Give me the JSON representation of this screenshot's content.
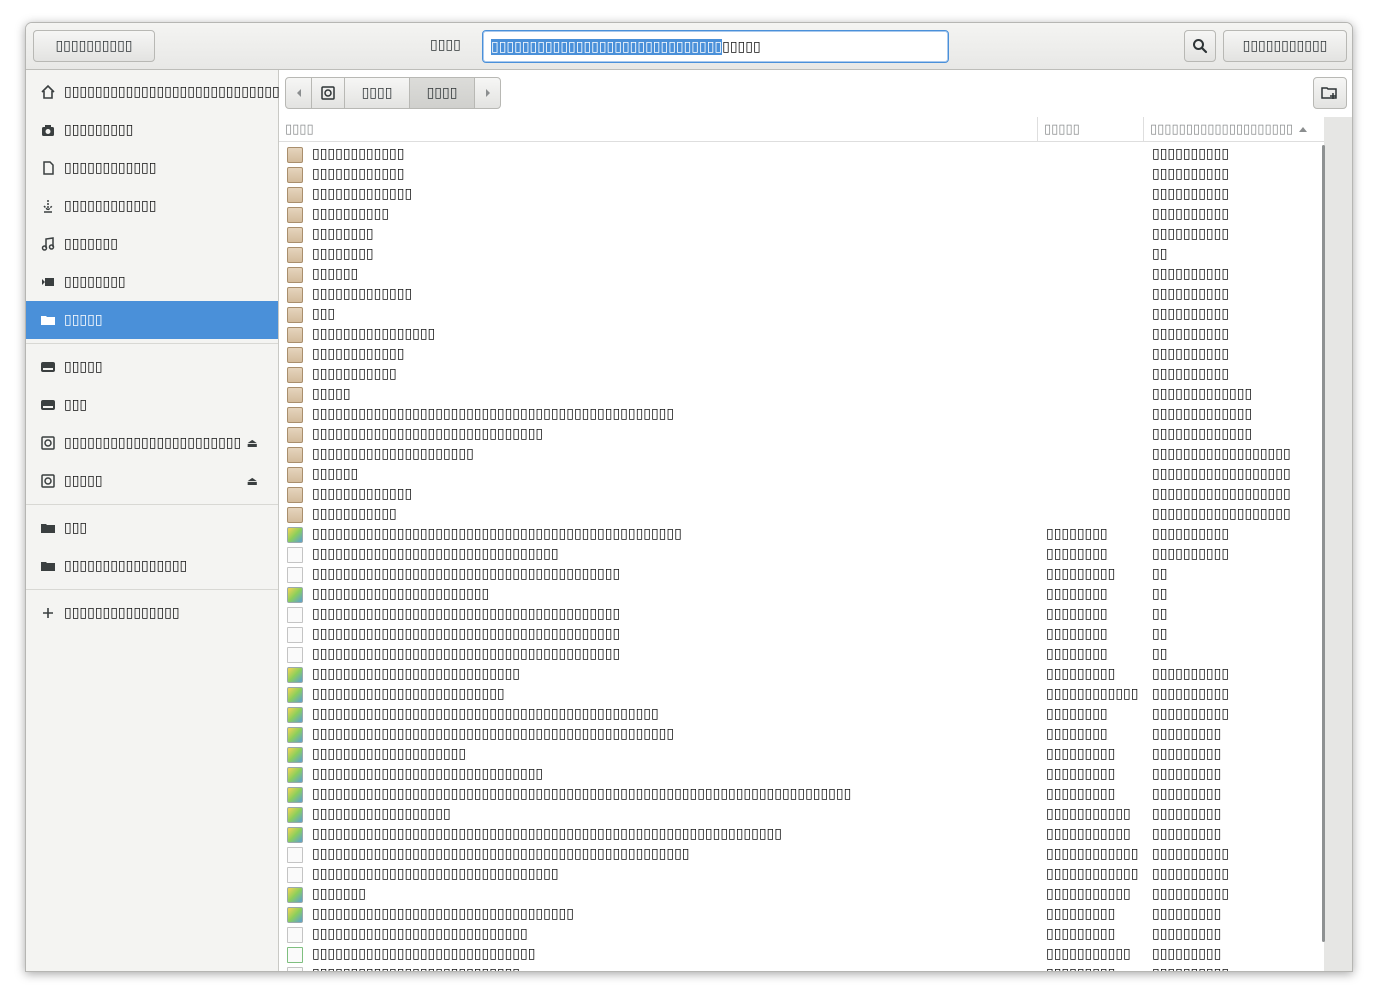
{
  "header": {
    "cancel_label": "▯▯▯▯▯▯▯▯▯▯",
    "name_label": "▯▯▯▯",
    "name_selected": "▯▯▯▯▯▯▯▯▯▯▯▯▯▯▯▯▯▯▯▯▯▯▯▯▯▯▯▯▯▯",
    "name_rest": "▯▯▯▯▯",
    "save_label": "▯▯▯▯▯▯▯▯▯▯▯"
  },
  "sidebar": {
    "items": [
      {
        "label": "▯▯▯▯▯▯▯▯▯▯▯▯▯▯▯▯▯▯▯▯▯▯▯▯▯▯▯▯",
        "icon": "home-icon"
      },
      {
        "label": "▯▯▯▯▯▯▯▯▯",
        "icon": "camera-icon"
      },
      {
        "label": "▯▯▯▯▯▯▯▯▯▯▯▯",
        "icon": "document-icon"
      },
      {
        "label": "▯▯▯▯▯▯▯▯▯▯▯▯",
        "icon": "download-icon"
      },
      {
        "label": "▯▯▯▯▯▯▯",
        "icon": "music-icon"
      },
      {
        "label": "▯▯▯▯▯▯▯▯",
        "icon": "video-icon"
      },
      {
        "label": "▯▯▯▯▯",
        "icon": "folder-icon"
      },
      {
        "label": "▯▯▯▯▯",
        "icon": "drive-icon"
      },
      {
        "label": "▯▯▯",
        "icon": "drive-icon"
      },
      {
        "label": "▯▯▯▯▯▯▯▯▯▯▯▯▯▯▯▯▯▯▯▯▯▯▯",
        "icon": "disc-icon"
      },
      {
        "label": "▯▯▯▯▯",
        "icon": "disc-icon"
      },
      {
        "label": "▯▯▯",
        "icon": "folder-icon"
      },
      {
        "label": "▯▯▯▯▯▯▯▯▯▯▯▯▯▯▯▯",
        "icon": "folder-icon"
      },
      {
        "label": "▯▯▯▯▯▯▯▯▯▯▯▯▯▯▯",
        "icon": "plus-icon"
      }
    ]
  },
  "pathbar": {
    "segments": [
      "▯▯▯▯",
      "▯▯▯▯"
    ]
  },
  "columns": {
    "name": "▯▯▯▯",
    "size": "▯▯▯▯▯",
    "modified": "▯▯▯▯▯▯▯▯▯▯▯▯▯▯▯▯▯▯▯▯"
  },
  "files": [
    {
      "name": "▯▯▯▯▯▯▯▯▯▯▯▯",
      "size": "",
      "modified": "▯▯▯▯▯▯▯▯▯▯",
      "type": "folder"
    },
    {
      "name": "▯▯▯▯▯▯▯▯▯▯▯▯",
      "size": "",
      "modified": "▯▯▯▯▯▯▯▯▯▯",
      "type": "folder"
    },
    {
      "name": "▯▯▯▯▯▯▯▯▯▯▯▯▯",
      "size": "",
      "modified": "▯▯▯▯▯▯▯▯▯▯",
      "type": "folder"
    },
    {
      "name": "▯▯▯▯▯▯▯▯▯▯",
      "size": "",
      "modified": "▯▯▯▯▯▯▯▯▯▯",
      "type": "folder"
    },
    {
      "name": "▯▯▯▯▯▯▯▯",
      "size": "",
      "modified": "▯▯▯▯▯▯▯▯▯▯",
      "type": "folder"
    },
    {
      "name": "▯▯▯▯▯▯▯▯",
      "size": "",
      "modified": "▯▯",
      "type": "folder"
    },
    {
      "name": "▯▯▯▯▯▯",
      "size": "",
      "modified": "▯▯▯▯▯▯▯▯▯▯",
      "type": "folder"
    },
    {
      "name": "▯▯▯▯▯▯▯▯▯▯▯▯▯",
      "size": "",
      "modified": "▯▯▯▯▯▯▯▯▯▯",
      "type": "folder"
    },
    {
      "name": "▯▯▯",
      "size": "",
      "modified": "▯▯▯▯▯▯▯▯▯▯",
      "type": "folder"
    },
    {
      "name": "▯▯▯▯▯▯▯▯▯▯▯▯▯▯▯▯",
      "size": "",
      "modified": "▯▯▯▯▯▯▯▯▯▯",
      "type": "folder"
    },
    {
      "name": "▯▯▯▯▯▯▯▯▯▯▯▯",
      "size": "",
      "modified": "▯▯▯▯▯▯▯▯▯▯",
      "type": "folder"
    },
    {
      "name": "▯▯▯▯▯▯▯▯▯▯▯",
      "size": "",
      "modified": "▯▯▯▯▯▯▯▯▯▯",
      "type": "folder"
    },
    {
      "name": "▯▯▯▯▯",
      "size": "",
      "modified": "▯▯▯▯▯▯▯▯▯▯▯▯▯",
      "type": "folder"
    },
    {
      "name": "▯▯▯▯▯▯▯▯▯▯▯▯▯▯▯▯▯▯▯▯▯▯▯▯▯▯▯▯▯▯▯▯▯▯▯▯▯▯▯▯▯▯▯▯▯▯▯",
      "size": "",
      "modified": "▯▯▯▯▯▯▯▯▯▯▯▯▯",
      "type": "folder"
    },
    {
      "name": "▯▯▯▯▯▯▯▯▯▯▯▯▯▯▯▯▯▯▯▯▯▯▯▯▯▯▯▯▯▯",
      "size": "",
      "modified": "▯▯▯▯▯▯▯▯▯▯▯▯▯",
      "type": "folder"
    },
    {
      "name": "▯▯▯▯▯▯▯▯▯▯▯▯▯▯▯▯▯▯▯▯▯",
      "size": "",
      "modified": "▯▯▯▯▯▯▯▯▯▯▯▯▯▯▯▯▯▯",
      "type": "folder"
    },
    {
      "name": "▯▯▯▯▯▯",
      "size": "",
      "modified": "▯▯▯▯▯▯▯▯▯▯▯▯▯▯▯▯▯▯",
      "type": "folder"
    },
    {
      "name": "▯▯▯▯▯▯▯▯▯▯▯▯▯",
      "size": "",
      "modified": "▯▯▯▯▯▯▯▯▯▯▯▯▯▯▯▯▯▯",
      "type": "folder"
    },
    {
      "name": "▯▯▯▯▯▯▯▯▯▯▯",
      "size": "",
      "modified": "▯▯▯▯▯▯▯▯▯▯▯▯▯▯▯▯▯▯",
      "type": "folder"
    },
    {
      "name": "▯▯▯▯▯▯▯▯▯▯▯▯▯▯▯▯▯▯▯▯▯▯▯▯▯▯▯▯▯▯▯▯▯▯▯▯▯▯▯▯▯▯▯▯▯▯▯▯",
      "size": "▯▯▯▯▯▯▯▯",
      "modified": "▯▯▯▯▯▯▯▯▯▯",
      "type": "image"
    },
    {
      "name": "▯▯▯▯▯▯▯▯▯▯▯▯▯▯▯▯▯▯▯▯▯▯▯▯▯▯▯▯▯▯▯▯",
      "size": "▯▯▯▯▯▯▯▯",
      "modified": "▯▯▯▯▯▯▯▯▯▯",
      "type": "doc"
    },
    {
      "name": "▯▯▯▯▯▯▯▯▯▯▯▯▯▯▯▯▯▯▯▯▯▯▯▯▯▯▯▯▯▯▯▯▯▯▯▯▯▯▯▯",
      "size": "▯▯▯▯▯▯▯▯▯",
      "modified": "▯▯",
      "type": "doc"
    },
    {
      "name": "▯▯▯▯▯▯▯▯▯▯▯▯▯▯▯▯▯▯▯▯▯▯▯",
      "size": "▯▯▯▯▯▯▯▯",
      "modified": "▯▯",
      "type": "image"
    },
    {
      "name": "▯▯▯▯▯▯▯▯▯▯▯▯▯▯▯▯▯▯▯▯▯▯▯▯▯▯▯▯▯▯▯▯▯▯▯▯▯▯▯▯",
      "size": "▯▯▯▯▯▯▯▯",
      "modified": "▯▯",
      "type": "doc"
    },
    {
      "name": "▯▯▯▯▯▯▯▯▯▯▯▯▯▯▯▯▯▯▯▯▯▯▯▯▯▯▯▯▯▯▯▯▯▯▯▯▯▯▯▯",
      "size": "▯▯▯▯▯▯▯▯",
      "modified": "▯▯",
      "type": "doc"
    },
    {
      "name": "▯▯▯▯▯▯▯▯▯▯▯▯▯▯▯▯▯▯▯▯▯▯▯▯▯▯▯▯▯▯▯▯▯▯▯▯▯▯▯▯",
      "size": "▯▯▯▯▯▯▯▯",
      "modified": "▯▯",
      "type": "doc"
    },
    {
      "name": "▯▯▯▯▯▯▯▯▯▯▯▯▯▯▯▯▯▯▯▯▯▯▯▯▯▯▯",
      "size": "▯▯▯▯▯▯▯▯▯",
      "modified": "▯▯▯▯▯▯▯▯▯▯",
      "type": "image"
    },
    {
      "name": "▯▯▯▯▯▯▯▯▯▯▯▯▯▯▯▯▯▯▯▯▯▯▯▯▯",
      "size": "▯▯▯▯▯▯▯▯▯▯▯▯",
      "modified": "▯▯▯▯▯▯▯▯▯▯",
      "type": "image"
    },
    {
      "name": "▯▯▯▯▯▯▯▯▯▯▯▯▯▯▯▯▯▯▯▯▯▯▯▯▯▯▯▯▯▯▯▯▯▯▯▯▯▯▯▯▯▯▯▯▯",
      "size": "▯▯▯▯▯▯▯▯",
      "modified": "▯▯▯▯▯▯▯▯▯▯",
      "type": "image"
    },
    {
      "name": "▯▯▯▯▯▯▯▯▯▯▯▯▯▯▯▯▯▯▯▯▯▯▯▯▯▯▯▯▯▯▯▯▯▯▯▯▯▯▯▯▯▯▯▯▯▯▯",
      "size": "▯▯▯▯▯▯▯▯",
      "modified": "▯▯▯▯▯▯▯▯▯",
      "type": "image"
    },
    {
      "name": "▯▯▯▯▯▯▯▯▯▯▯▯▯▯▯▯▯▯▯▯",
      "size": "▯▯▯▯▯▯▯▯▯",
      "modified": "▯▯▯▯▯▯▯▯▯",
      "type": "image"
    },
    {
      "name": "▯▯▯▯▯▯▯▯▯▯▯▯▯▯▯▯▯▯▯▯▯▯▯▯▯▯▯▯▯▯",
      "size": "▯▯▯▯▯▯▯▯▯",
      "modified": "▯▯▯▯▯▯▯▯▯",
      "type": "image"
    },
    {
      "name": "▯▯▯▯▯▯▯▯▯▯▯▯▯▯▯▯▯▯▯▯▯▯▯▯▯▯▯▯▯▯▯▯▯▯▯▯▯▯▯▯▯▯▯▯▯▯▯▯▯▯▯▯▯▯▯▯▯▯▯▯▯▯▯▯▯▯▯▯▯▯",
      "size": "▯▯▯▯▯▯▯▯▯",
      "modified": "▯▯▯▯▯▯▯▯▯",
      "type": "image"
    },
    {
      "name": "▯▯▯▯▯▯▯▯▯▯▯▯▯▯▯▯▯▯",
      "size": "▯▯▯▯▯▯▯▯▯▯▯",
      "modified": "▯▯▯▯▯▯▯▯▯",
      "type": "image"
    },
    {
      "name": "▯▯▯▯▯▯▯▯▯▯▯▯▯▯▯▯▯▯▯▯▯▯▯▯▯▯▯▯▯▯▯▯▯▯▯▯▯▯▯▯▯▯▯▯▯▯▯▯▯▯▯▯▯▯▯▯▯▯▯▯▯",
      "size": "▯▯▯▯▯▯▯▯▯▯▯",
      "modified": "▯▯▯▯▯▯▯▯▯",
      "type": "image"
    },
    {
      "name": "▯▯▯▯▯▯▯▯▯▯▯▯▯▯▯▯▯▯▯▯▯▯▯▯▯▯▯▯▯▯▯▯▯▯▯▯▯▯▯▯▯▯▯▯▯▯▯▯▯",
      "size": "▯▯▯▯▯▯▯▯▯▯▯▯",
      "modified": "▯▯▯▯▯▯▯▯▯▯",
      "type": "doc"
    },
    {
      "name": "▯▯▯▯▯▯▯▯▯▯▯▯▯▯▯▯▯▯▯▯▯▯▯▯▯▯▯▯▯▯▯▯",
      "size": "▯▯▯▯▯▯▯▯▯▯▯▯",
      "modified": "▯▯▯▯▯▯▯▯▯▯",
      "type": "doc"
    },
    {
      "name": "▯▯▯▯▯▯▯",
      "size": "▯▯▯▯▯▯▯▯▯▯▯",
      "modified": "▯▯▯▯▯▯▯▯▯▯",
      "type": "image"
    },
    {
      "name": "▯▯▯▯▯▯▯▯▯▯▯▯▯▯▯▯▯▯▯▯▯▯▯▯▯▯▯▯▯▯▯▯▯▯",
      "size": "▯▯▯▯▯▯▯▯▯",
      "modified": "▯▯▯▯▯▯▯▯▯",
      "type": "image"
    },
    {
      "name": "▯▯▯▯▯▯▯▯▯▯▯▯▯▯▯▯▯▯▯▯▯▯▯▯▯▯▯▯",
      "size": "▯▯▯▯▯▯▯▯▯",
      "modified": "▯▯▯▯▯▯▯▯▯",
      "type": "doc"
    },
    {
      "name": "▯▯▯▯▯▯▯▯▯▯▯▯▯▯▯▯▯▯▯▯▯▯▯▯▯▯▯▯▯",
      "size": "▯▯▯▯▯▯▯▯▯▯▯",
      "modified": "▯▯▯▯▯▯▯▯▯",
      "type": "sheet"
    },
    {
      "name": "▯▯▯▯▯▯▯▯▯▯▯▯▯▯▯▯▯▯▯▯▯▯▯▯▯▯▯",
      "size": "▯▯▯▯▯▯▯▯▯",
      "modified": "▯▯▯▯▯▯▯▯▯▯",
      "type": "doc"
    }
  ],
  "colors": {
    "accent": "#4a90d9",
    "sidebar_bg": "#f4f4f2",
    "headerbar_bg": "#e8e8e6"
  }
}
